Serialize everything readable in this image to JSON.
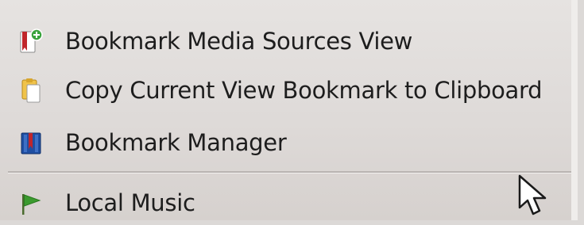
{
  "menu": {
    "items": [
      {
        "label": "Bookmark Media Sources View",
        "icon": "bookmark-add-icon"
      },
      {
        "label": "Copy Current View Bookmark to Clipboard",
        "icon": "clipboard-copy-icon"
      },
      {
        "label": "Bookmark Manager",
        "icon": "bookmark-manager-icon"
      },
      {
        "label": "Local Music",
        "icon": "green-flag-icon"
      }
    ]
  },
  "colors": {
    "menu_background": "#dedad8",
    "text": "#1d1d1d",
    "separator": "#b9b4b1",
    "bookmark_red": "#c0262b",
    "add_badge_green": "#3aa33d",
    "clipboard_yellow": "#f0c34a",
    "manager_blue": "#1f4fa3",
    "flag_green": "#3b9a2e"
  }
}
